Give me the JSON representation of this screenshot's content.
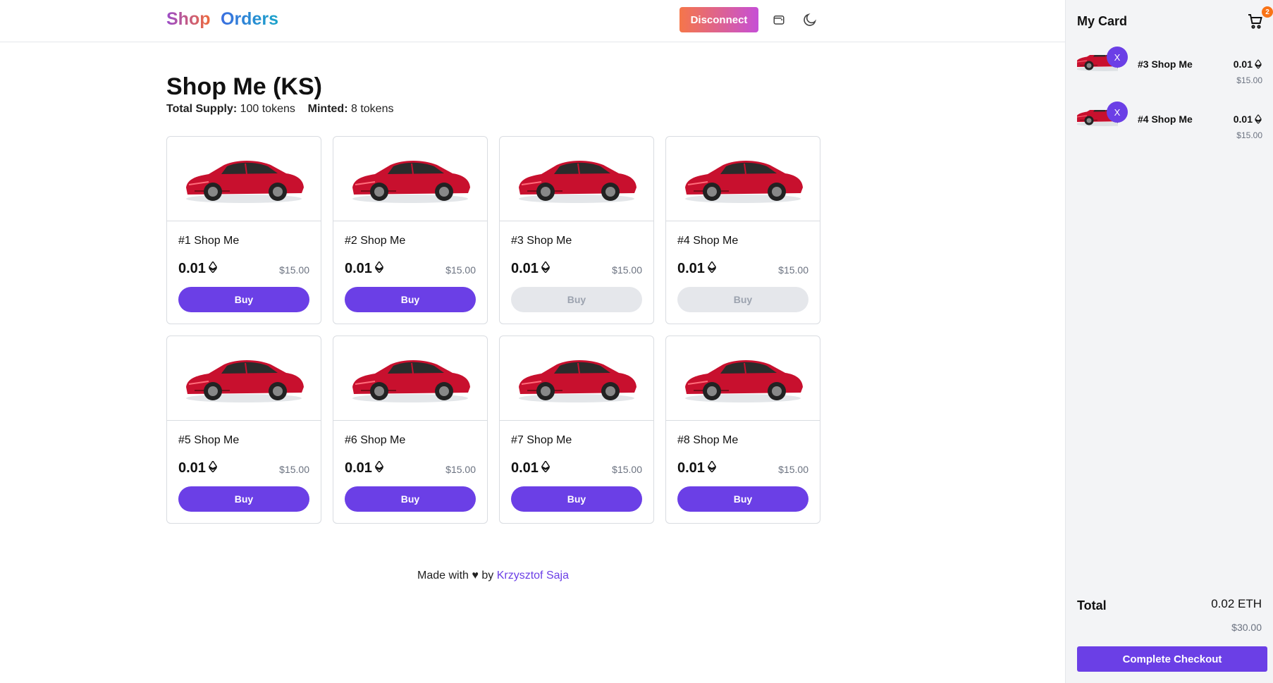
{
  "header": {
    "nav_shop": "Shop",
    "nav_orders": "Orders",
    "disconnect_label": "Disconnect",
    "icons": [
      "wallet-icon",
      "moon-icon"
    ]
  },
  "main": {
    "title": "Shop Me (KS)",
    "total_supply_label": "Total Supply:",
    "total_supply_value": "100 tokens",
    "minted_label": "Minted:",
    "minted_value": "8 tokens"
  },
  "products": [
    {
      "name": "#1 Shop Me",
      "eth": "0.01",
      "usd": "$15.00",
      "buy_label": "Buy",
      "disabled": false
    },
    {
      "name": "#2 Shop Me",
      "eth": "0.01",
      "usd": "$15.00",
      "buy_label": "Buy",
      "disabled": false
    },
    {
      "name": "#3 Shop Me",
      "eth": "0.01",
      "usd": "$15.00",
      "buy_label": "Buy",
      "disabled": true
    },
    {
      "name": "#4 Shop Me",
      "eth": "0.01",
      "usd": "$15.00",
      "buy_label": "Buy",
      "disabled": true
    },
    {
      "name": "#5 Shop Me",
      "eth": "0.01",
      "usd": "$15.00",
      "buy_label": "Buy",
      "disabled": false
    },
    {
      "name": "#6 Shop Me",
      "eth": "0.01",
      "usd": "$15.00",
      "buy_label": "Buy",
      "disabled": false
    },
    {
      "name": "#7 Shop Me",
      "eth": "0.01",
      "usd": "$15.00",
      "buy_label": "Buy",
      "disabled": false
    },
    {
      "name": "#8 Shop Me",
      "eth": "0.01",
      "usd": "$15.00",
      "buy_label": "Buy",
      "disabled": false
    }
  ],
  "footer": {
    "made_with": "Made with",
    "by": "by",
    "author": "Krzysztof Saja"
  },
  "sidebar": {
    "title": "My Card",
    "cart_count": "2",
    "items": [
      {
        "remove_label": "X",
        "name": "#3 Shop Me",
        "eth": "0.01",
        "usd": "$15.00"
      },
      {
        "remove_label": "X",
        "name": "#4 Shop Me",
        "eth": "0.01",
        "usd": "$15.00"
      }
    ],
    "total_label": "Total",
    "total_eth": "0.02 ETH",
    "total_usd": "$30.00",
    "checkout_label": "Complete Checkout"
  },
  "colors": {
    "accent": "#6b3fe6",
    "disabled_button": "#e5e7eb",
    "car_red": "#c8102e",
    "badge": "#f97316"
  }
}
